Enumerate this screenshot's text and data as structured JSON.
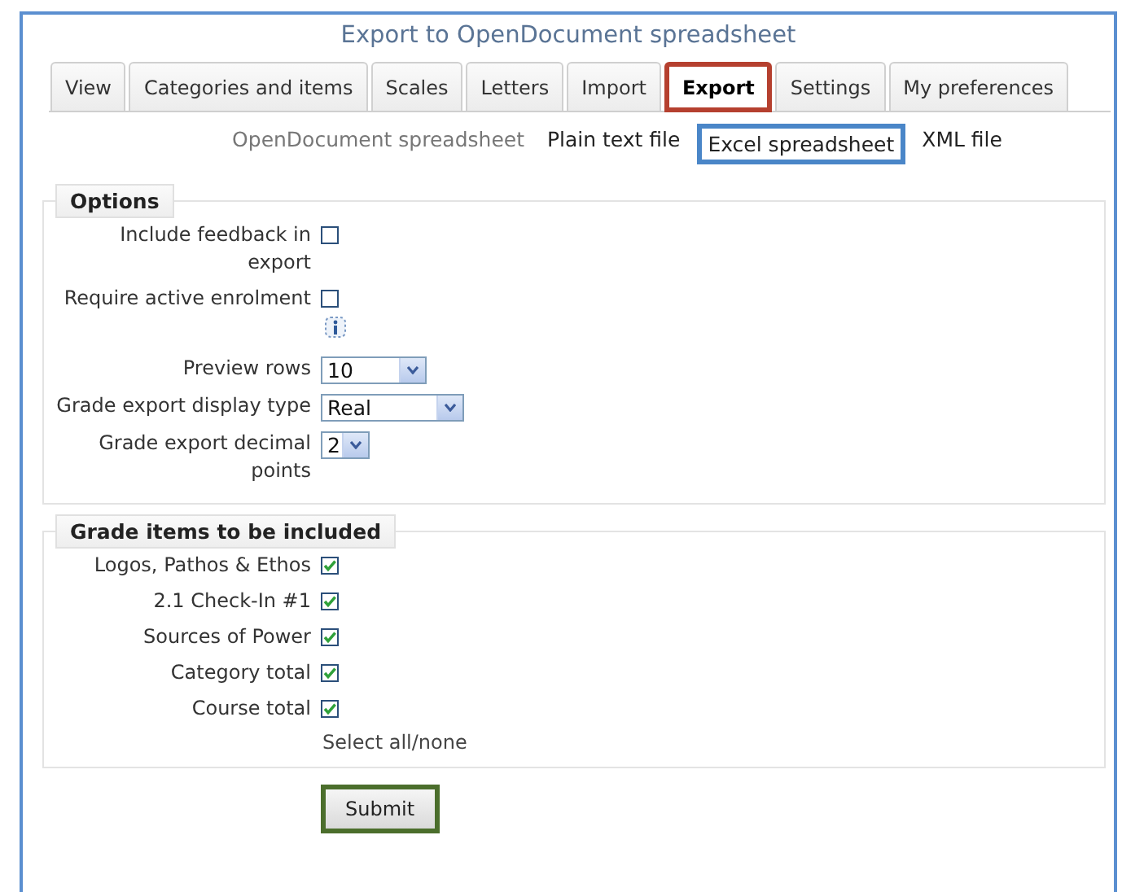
{
  "page": {
    "title": "Export to OpenDocument spreadsheet"
  },
  "tabs": [
    {
      "label": "View",
      "selected": false
    },
    {
      "label": "Categories and items",
      "selected": false
    },
    {
      "label": "Scales",
      "selected": false
    },
    {
      "label": "Letters",
      "selected": false
    },
    {
      "label": "Import",
      "selected": false
    },
    {
      "label": "Export",
      "selected": true,
      "color": "#b5402f"
    },
    {
      "label": "Settings",
      "selected": false
    },
    {
      "label": "My preferences",
      "selected": false
    }
  ],
  "subtabs": [
    {
      "label": "OpenDocument spreadsheet",
      "selected": true
    },
    {
      "label": "Plain text file",
      "selected": false
    },
    {
      "label": "Excel spreadsheet",
      "selected": false,
      "color": "#4a86c8"
    },
    {
      "label": "XML file",
      "selected": false
    }
  ],
  "options": {
    "legend": "Options",
    "fields": [
      {
        "kind": "checkbox",
        "label": "Include feedback in export",
        "checked": false
      },
      {
        "kind": "checkbox",
        "label": "Require active enrolment",
        "checked": false,
        "help": true
      },
      {
        "kind": "select",
        "label": "Preview rows",
        "value": "10"
      },
      {
        "kind": "select",
        "label": "Grade export display type",
        "value": "Real"
      },
      {
        "kind": "select",
        "label": "Grade export decimal points",
        "value": "2"
      }
    ]
  },
  "grade_items": {
    "legend": "Grade items to be included",
    "items": [
      {
        "label": "Logos, Pathos & Ethos",
        "checked": true
      },
      {
        "label": "2.1 Check-In #1",
        "checked": true
      },
      {
        "label": "Sources of Power",
        "checked": true
      },
      {
        "label": "Category total",
        "checked": true
      },
      {
        "label": "Course total",
        "checked": true
      }
    ],
    "select_all": "Select all/none"
  },
  "submit": {
    "label": "Submit",
    "color": "#4b6e2c"
  }
}
